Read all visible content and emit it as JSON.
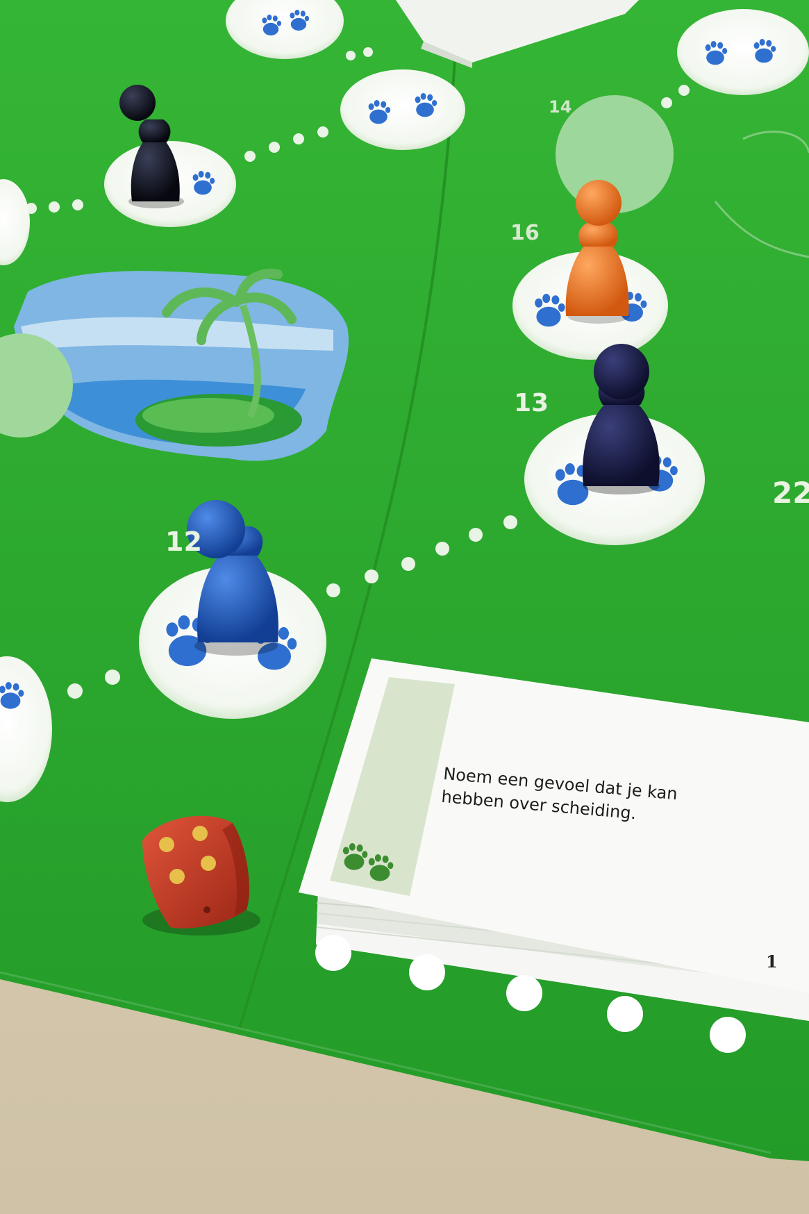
{
  "scene": {
    "description_kind": "photo",
    "board_color": "#2fa82f",
    "space_numbers": [
      "16",
      "14",
      "13",
      "22",
      "12"
    ],
    "card": {
      "text": "Noem een gevoel dat je kan\nhebben over scheiding.",
      "number": "1",
      "icon": "paw-prints-icon"
    },
    "die": {
      "color": "#c23a24",
      "pips_shown": 4
    },
    "pawns": [
      {
        "color": "black",
        "hex": "#141a2c"
      },
      {
        "color": "orange",
        "hex": "#f07a25"
      },
      {
        "color": "dark-navy",
        "hex": "#1a1d4a"
      },
      {
        "color": "blue",
        "hex": "#1e5fc4"
      }
    ]
  }
}
